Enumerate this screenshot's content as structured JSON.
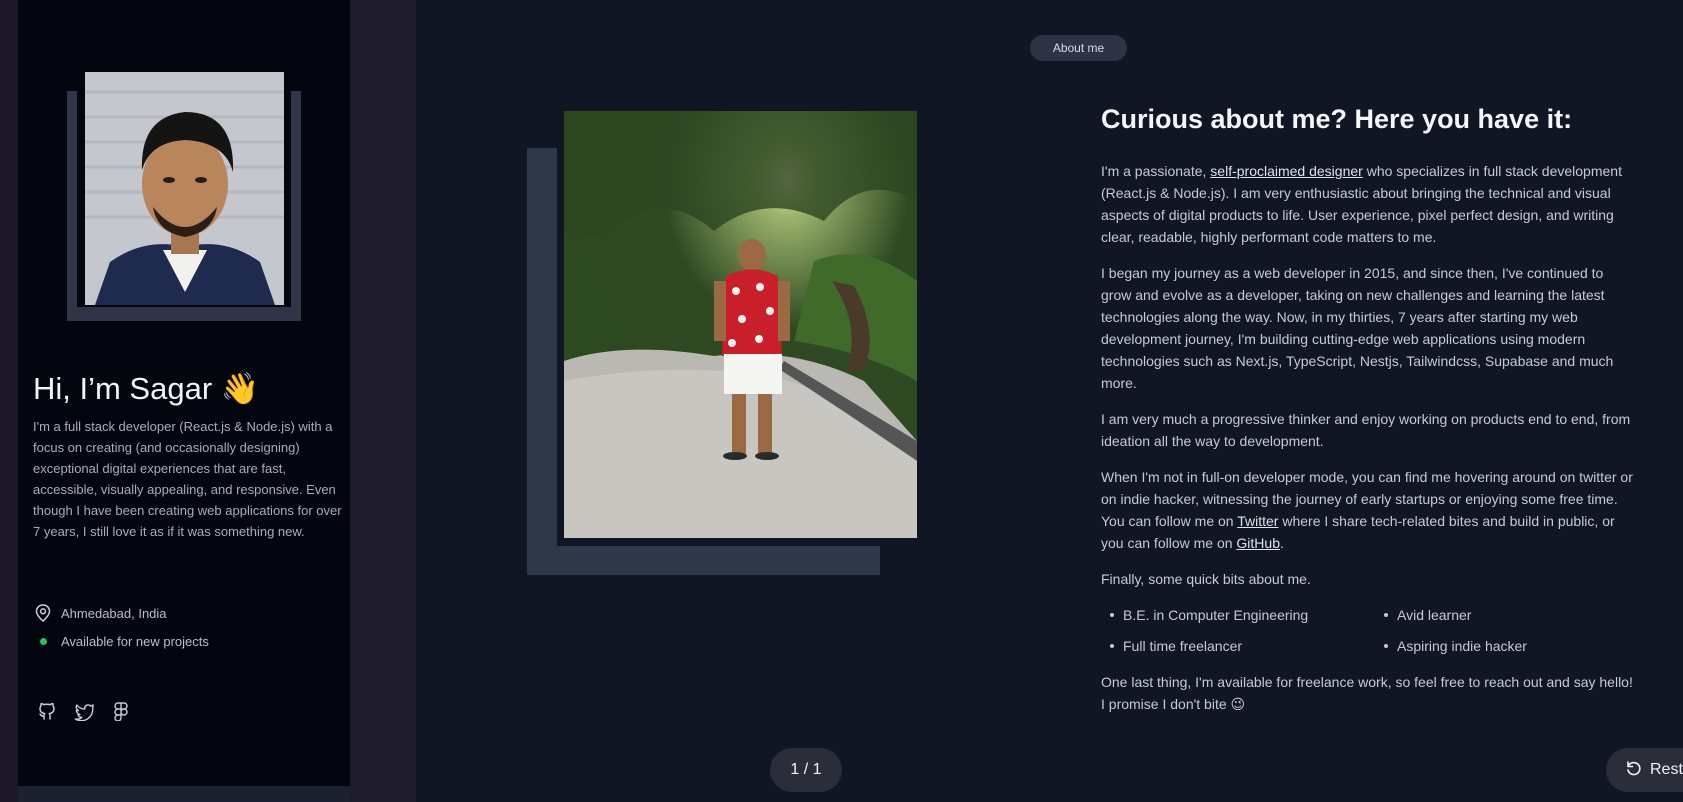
{
  "sidebar": {
    "greeting": "Hi, I’m Sagar",
    "wave": "👋",
    "bio": "I'm a full stack developer (React.js & Node.js) with a focus on creating (and occasionally designing) exceptional digital experiences that are fast, accessible, visually appealing, and responsive. Even though I have been creating web applications for over 7 years, I still love it as if it was something new.",
    "location": "Ahmedabad, India",
    "availability": "Available for new projects",
    "status_color": "#22c55e",
    "socials": [
      "github-icon",
      "twitter-icon",
      "figma-icon"
    ]
  },
  "main": {
    "section_label": "About me",
    "heading": "Curious about me? Here you have it:",
    "p1": {
      "before": "I'm a passionate, ",
      "link": "self-proclaimed designer",
      "after": " who specializes in full stack development (React.js & Node.js). I am very enthusiastic about bringing the technical and visual aspects of digital products to life. User experience, pixel perfect design, and writing clear, readable, highly performant code matters to me."
    },
    "p2": "I began my journey as a web developer in 2015, and since then, I've continued to grow and evolve as a developer, taking on new challenges and learning the latest technologies along the way. Now, in my thirties, 7 years after starting my web development journey, I'm building cutting-edge web applications using modern technologies such as Next.js, TypeScript, Nestjs, Tailwindcss, Supabase and much more.",
    "p3": "I am very much a progressive thinker and enjoy working on products end to end, from ideation all the way to development.",
    "p4": {
      "a": "When I'm not in full-on developer mode, you can find me hovering around on twitter or on indie hacker, witnessing the journey of early startups or enjoying some free time. You can follow me on ",
      "twitter": "Twitter",
      "b": " where I share tech-related bites and build in public, or you can follow me on ",
      "github": "GitHub",
      "c": "."
    },
    "p5": "Finally, some quick bits about me.",
    "bits": [
      "B.E. in Computer Engineering",
      "Avid learner",
      "Full time freelancer",
      "Aspiring indie hacker"
    ],
    "p6": "One last thing, I'm available for freelance work, so feel free to reach out and say hello! I promise I don't bite 😉"
  },
  "pager": "1 / 1",
  "restore_label": "Rest",
  "colors": {
    "background": "#111624",
    "sidebar": "#04060f",
    "accent_frame": "#2f3849"
  }
}
